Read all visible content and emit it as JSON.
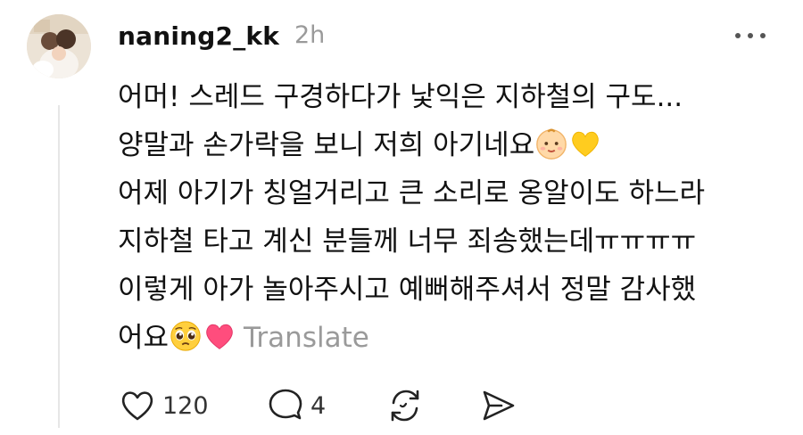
{
  "post": {
    "username": "naning2_kk",
    "timestamp": "2h",
    "lines": [
      "어머! 스레드 구경하다가 낯익은 지하철의 구도...",
      "양말과 손가락을 보니 저희 아기네요",
      "어제 아기가 칭얼거리고 큰 소리로 옹알이도 하느라",
      "지하철 타고 계신 분들께 너무 죄송했는데ㅠㅠㅠㅠ",
      "이렇게 아가 놀아주시고 예뻐해주셔서 정말 감사했",
      "어요"
    ],
    "translate_label": "Translate",
    "emojis": [
      "baby-face-emoji",
      "yellow-heart-emoji",
      "pleading-face-emoji",
      "pink-heart-emoji"
    ]
  },
  "actions": {
    "like_count": "120",
    "reply_count": "4",
    "icons": [
      "heart-icon",
      "comment-icon",
      "repost-icon",
      "share-icon",
      "more-icon"
    ]
  },
  "colors": {
    "text": "#111111",
    "muted": "#9a9a9a",
    "thread_line": "#e6e6e6",
    "yellow_heart": "#ffcc1f",
    "pink_heart": "#ff4d7d"
  }
}
